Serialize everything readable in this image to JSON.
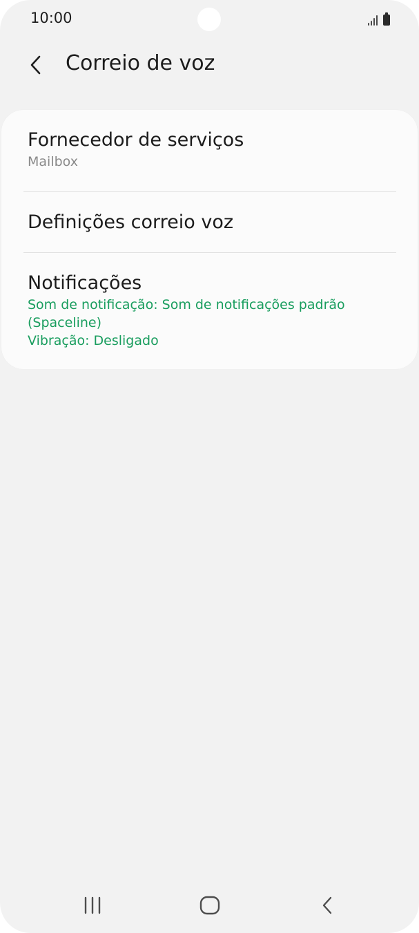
{
  "status_bar": {
    "time": "10:00"
  },
  "header": {
    "title": "Correio de voz",
    "back_icon": "chevron-left-icon"
  },
  "settings": {
    "items": [
      {
        "title": "Fornecedor de serviços",
        "subtitle": "Mailbox"
      },
      {
        "title": "Definições correio voz"
      },
      {
        "title": "Notificações",
        "subtitle_lines": [
          "Som de notificação: Som de notificações padrão",
          "(Spaceline)",
          "Vibração: Desligado"
        ]
      }
    ]
  },
  "nav_bar": {
    "icons": [
      "recent-apps-icon",
      "home-icon",
      "back-icon"
    ]
  },
  "colors": {
    "background": "#f2f2f2",
    "card": "#fbfbfb",
    "accent_green": "#199d5e",
    "subtitle_gray": "#8a8a8a",
    "text": "#1c1c1c"
  }
}
